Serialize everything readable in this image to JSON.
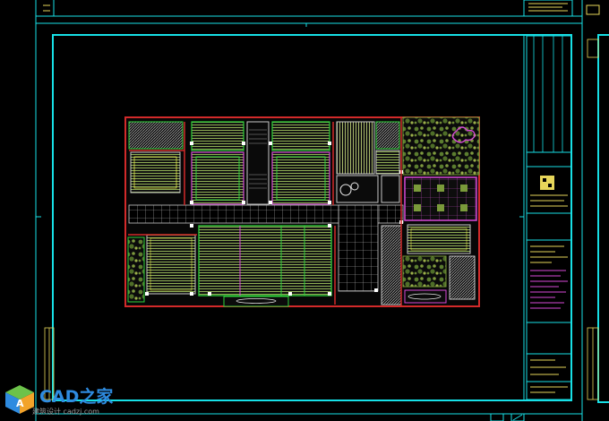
{
  "drawing": {
    "background": "#000000",
    "colors": {
      "border": "#17e0e6",
      "wall": "#d22a2a",
      "partition": "#2fd13b",
      "grid": "#c8c8c8",
      "furniture": "#e6e64a",
      "planting": "#7a9a3a",
      "magenta": "#d84ad8",
      "yellow": "#e6d65a"
    },
    "view": "floor-plan"
  },
  "watermark": {
    "brand": "CAD之家",
    "url": "建筑设计 cadzj.com",
    "icon": "cube-logo-icon"
  }
}
